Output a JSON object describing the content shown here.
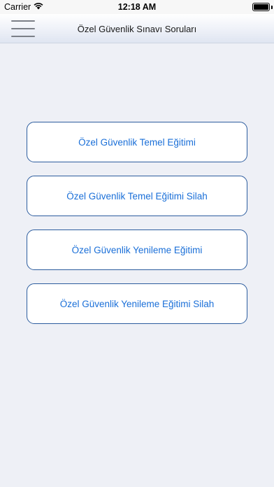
{
  "status_bar": {
    "carrier": "Carrier",
    "time": "12:18 AM"
  },
  "nav_bar": {
    "title": "Özel Güvenlik Sınavı Soruları"
  },
  "menu": {
    "items": [
      {
        "label": "Özel Güvenlik Temel Eğitimi"
      },
      {
        "label": "Özel Güvenlik Temel Eğitimi Silah"
      },
      {
        "label": "Özel Güvenlik Yenileme Eğitimi"
      },
      {
        "label": "Özel Güvenlik Yenileme Eğitimi Silah"
      }
    ]
  },
  "colors": {
    "accent": "#1a6fd8",
    "border": "#2c5c9e",
    "background": "#eef0f6"
  }
}
